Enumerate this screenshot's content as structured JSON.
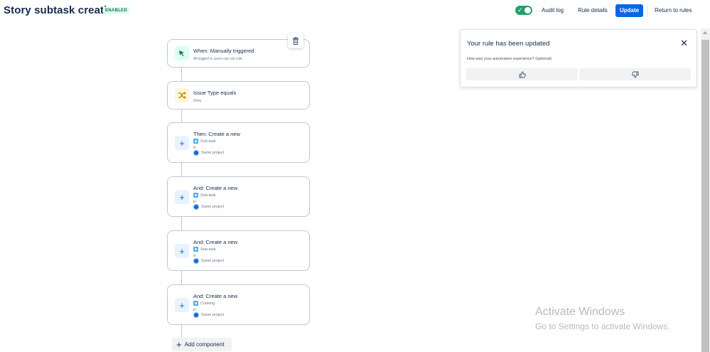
{
  "header": {
    "title": "Story subtask creation",
    "status_badge": "ENABLED",
    "enabled": true,
    "audit_log": "Audit log",
    "rule_details": "Rule details",
    "update": "Update",
    "return_to_rules": "Return to rules"
  },
  "components": [
    {
      "title": "When: Manually triggered",
      "subtitle": "All logged in users can run rule.",
      "icon": "cursor-click-icon",
      "color": "#22a06b"
    },
    {
      "title": "Issue Type equals",
      "subtitle": "Story",
      "icon": "shuffle-icon",
      "color": "#e2b203"
    },
    {
      "title": "Then: Create a new",
      "issue_type": "Sub-task",
      "in": "in",
      "project": "Same project",
      "icon": "plus-icon"
    },
    {
      "title": "And: Create a new",
      "issue_type": "Sub-task",
      "in": "in",
      "project": "Same project",
      "icon": "plus-icon"
    },
    {
      "title": "And: Create a new",
      "issue_type": "Sub-task",
      "in": "in",
      "project": "Same project",
      "icon": "plus-icon"
    },
    {
      "title": "And: Create a new",
      "issue_type": "Cooking",
      "in": "in",
      "project": "Same project",
      "icon": "plus-icon"
    }
  ],
  "add_component": "Add component",
  "flag": {
    "title": "Your rule has been updated",
    "question": "How was your automation experience? (optional)"
  },
  "watermark": {
    "line1": "Activate Windows",
    "line2": "Go to Settings to activate Windows."
  },
  "colors": {
    "primary": "#0c66e4",
    "success": "#22a06b",
    "condition": "#e2b203"
  }
}
